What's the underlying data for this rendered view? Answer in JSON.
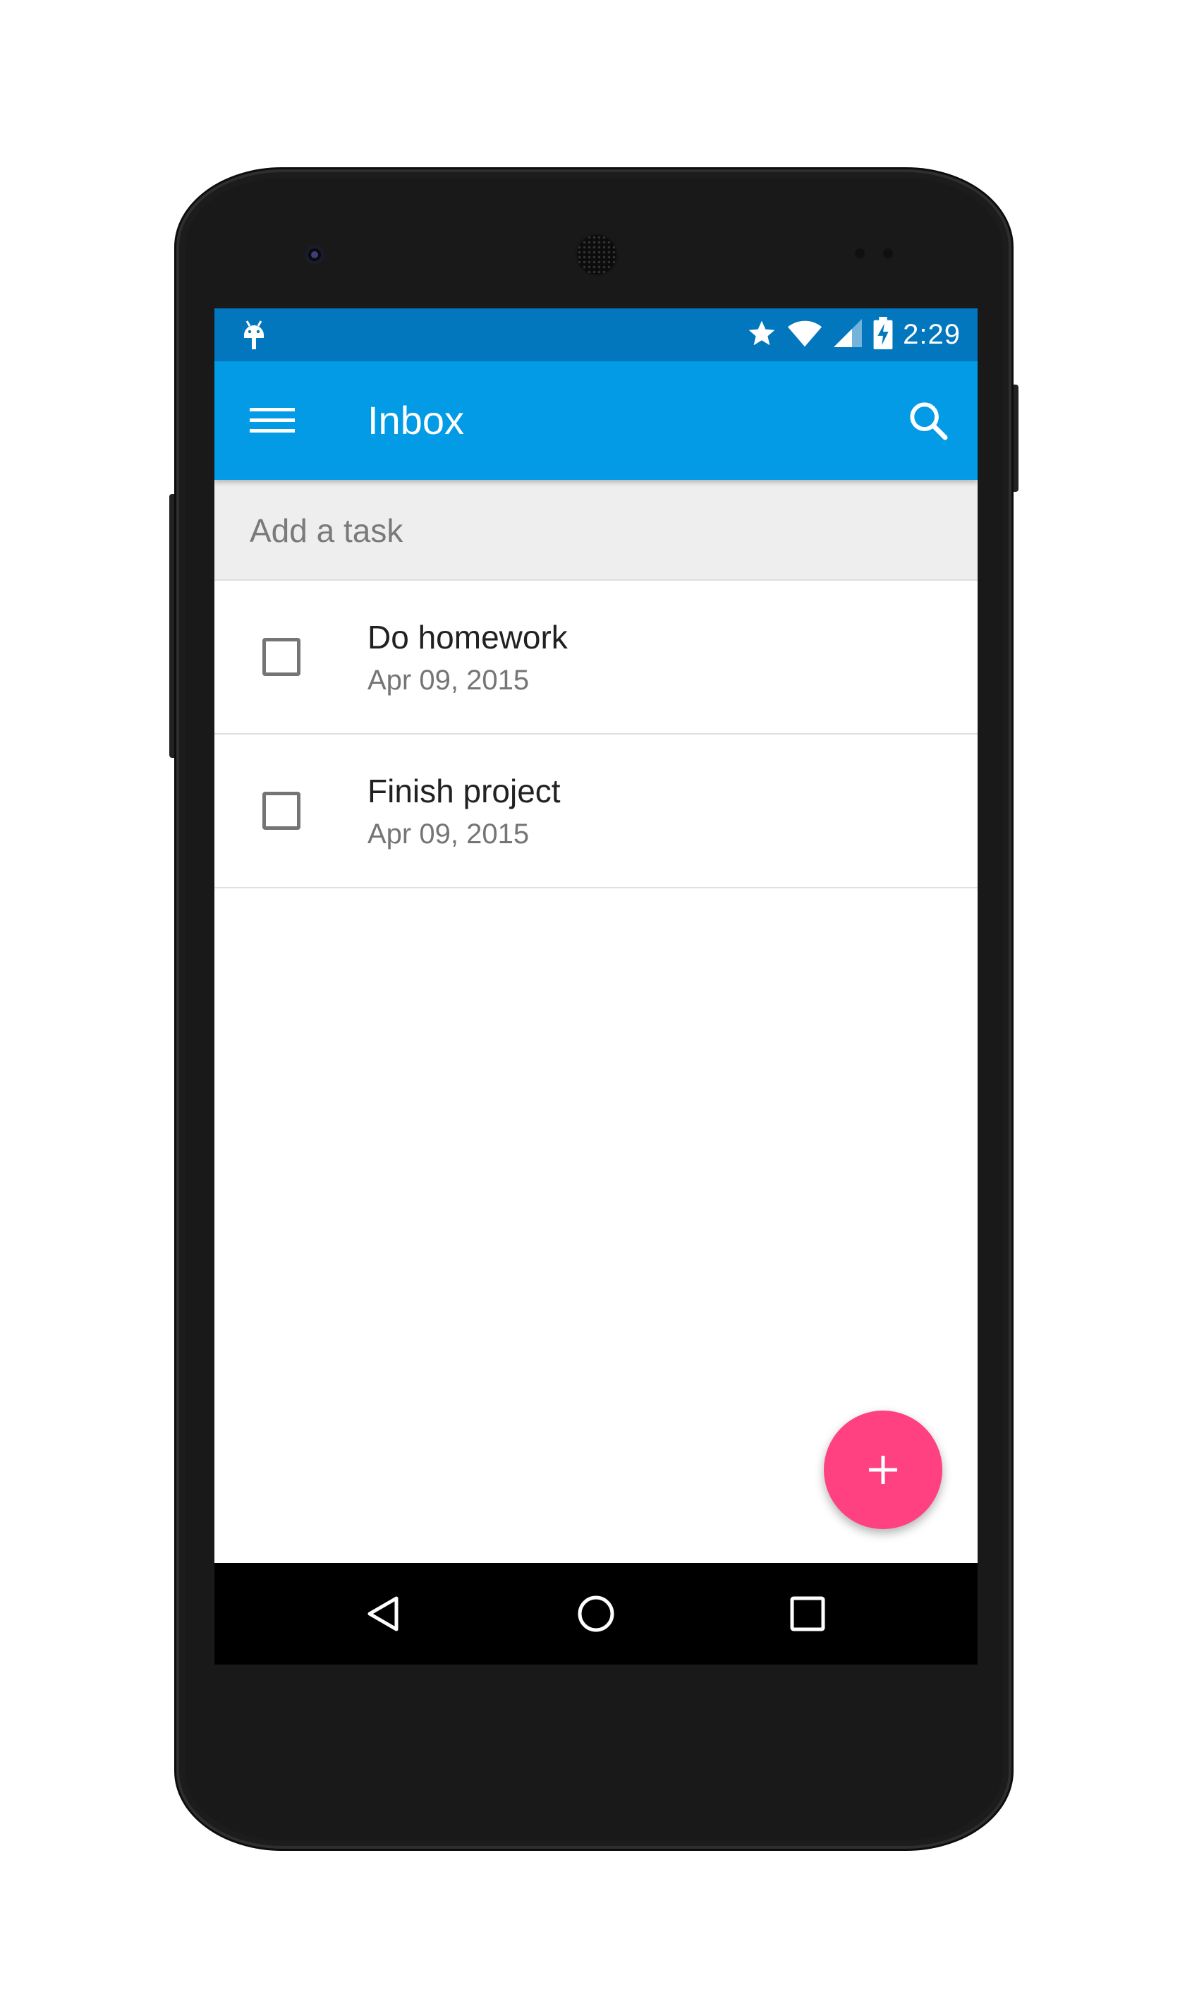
{
  "status_bar": {
    "notification_icon": "android-debug-icon",
    "icons": [
      "star-icon",
      "wifi-icon",
      "cell-signal-icon",
      "battery-charging-icon"
    ],
    "time": "2:29",
    "background_color": "#0277bd"
  },
  "app_bar": {
    "menu_icon": "hamburger-menu-icon",
    "title": "Inbox",
    "search_icon": "search-icon",
    "background_color": "#039be5"
  },
  "add_task": {
    "placeholder": "Add a task",
    "value": ""
  },
  "tasks": [
    {
      "title": "Do homework",
      "date": "Apr 09, 2015",
      "checked": false
    },
    {
      "title": "Finish project",
      "date": "Apr 09, 2015",
      "checked": false
    }
  ],
  "fab": {
    "icon": "plus-icon",
    "color": "#ff4081"
  },
  "nav_bar": {
    "buttons": [
      "back-triangle-icon",
      "home-circle-icon",
      "recents-square-icon"
    ]
  }
}
